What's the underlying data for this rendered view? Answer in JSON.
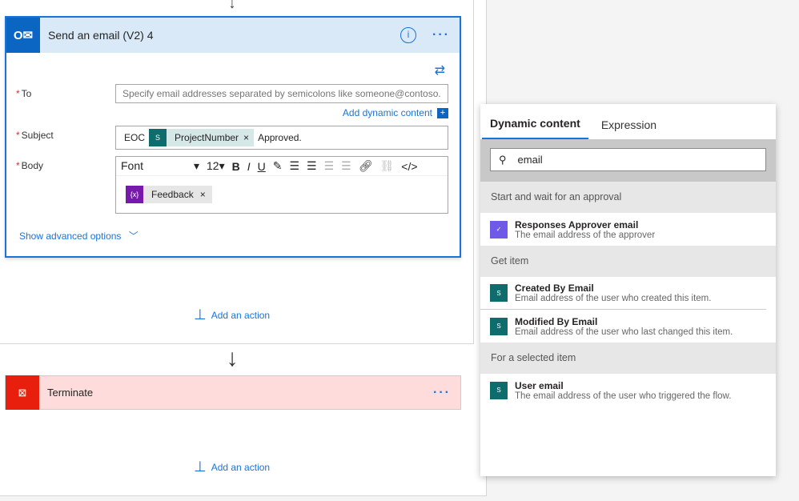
{
  "email_card": {
    "title": "Send an email (V2) 4",
    "icon": "outlook-icon",
    "to": {
      "label": "To",
      "placeholder": "Specify email addresses separated by semicolons like someone@contoso.com"
    },
    "add_dynamic": "Add dynamic content",
    "subject": {
      "label": "Subject",
      "prefix": "EOC",
      "token": "ProjectNumber",
      "suffix": "Approved."
    },
    "body": {
      "label": "Body",
      "font": "Font",
      "size": "12",
      "token": "Feedback"
    },
    "advanced": "Show advanced options"
  },
  "add_action": "Add an action",
  "terminate": {
    "title": "Terminate"
  },
  "panel": {
    "tabs": [
      "Dynamic content",
      "Expression"
    ],
    "search_value": "email",
    "groups": [
      {
        "name": "Start and wait for an approval",
        "items": [
          {
            "title": "Responses Approver email",
            "desc": "The email address of the approver",
            "icon": "approvals-icon"
          }
        ]
      },
      {
        "name": "Get item",
        "items": [
          {
            "title": "Created By Email",
            "desc": "Email address of the user who created this item.",
            "icon": "sharepoint-icon"
          },
          {
            "title": "Modified By Email",
            "desc": "Email address of the user who last changed this item.",
            "icon": "sharepoint-icon"
          }
        ]
      },
      {
        "name": "For a selected item",
        "items": [
          {
            "title": "User email",
            "desc": "The email address of the user who triggered the flow.",
            "icon": "sharepoint-icon"
          }
        ]
      }
    ]
  },
  "colors": {
    "accent": "#1a73d9",
    "outlook": "#0a66c2",
    "terminate": "#e81f0d",
    "sharepoint": "#0f6c6c",
    "variable": "#7719aa"
  }
}
